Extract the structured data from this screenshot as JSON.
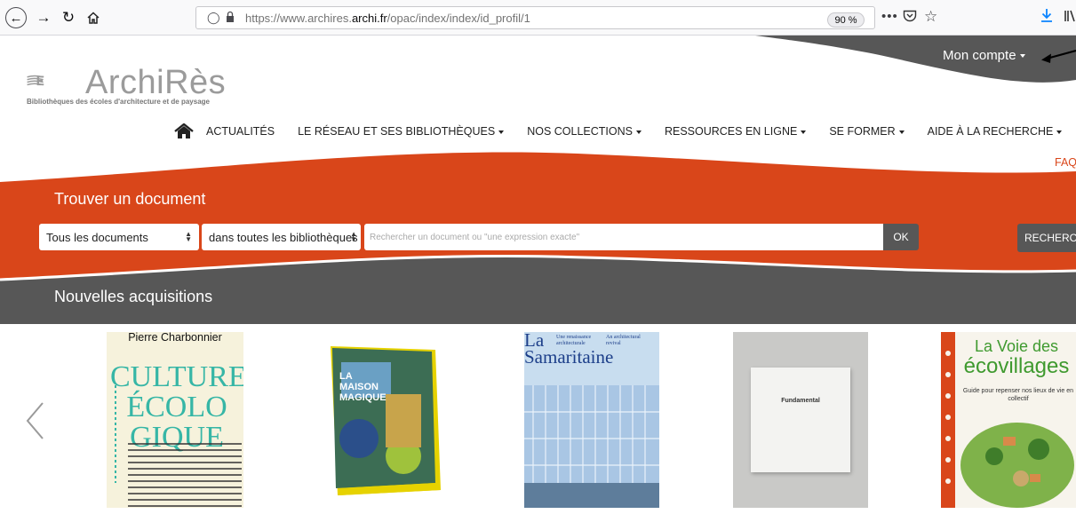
{
  "browser": {
    "url_prefix": "https://www.archires.",
    "url_domain": "archi.fr",
    "url_path": "/opac/index/index/id_profil/1",
    "zoom": "90 %",
    "more_label": "•••"
  },
  "header": {
    "account_label": "Mon compte",
    "logo_text": "ArchiRès",
    "logo_subtitle": "Bibliothèques des écoles d'architecture et de paysage"
  },
  "nav": {
    "items": [
      {
        "label": "ACTUALITÉS",
        "has_menu": false
      },
      {
        "label": "LE RÉSEAU ET SES BIBLIOTHÈQUES",
        "has_menu": true
      },
      {
        "label": "NOS COLLECTIONS",
        "has_menu": true
      },
      {
        "label": "RESSOURCES EN LIGNE",
        "has_menu": true
      },
      {
        "label": "SE FORMER",
        "has_menu": true
      },
      {
        "label": "AIDE À LA RECHERCHE",
        "has_menu": true
      }
    ],
    "faq": "FAQ"
  },
  "search": {
    "title": "Trouver un document",
    "doc_type": "Tous les documents",
    "library": "dans toutes les bibliothèques",
    "placeholder": "Rechercher un document ou \"une expression exacte\"",
    "ok_label": "OK",
    "advanced_label": "RECHERCHE"
  },
  "acquisitions": {
    "title": "Nouvelles acquisitions",
    "books": [
      {
        "author": "Pierre Charbonnier",
        "title_lines": [
          "CULTURE",
          "ÉCOLO",
          "GIQUE"
        ]
      },
      {
        "title_lines": [
          "LA MAISON",
          "MAGIQUE"
        ]
      },
      {
        "title_lines": [
          "La",
          "Samaritaine"
        ],
        "tagline_fr": "Une renaissance architecturale",
        "tagline_en": "An architectural revival"
      },
      {
        "title": "Fundamental"
      },
      {
        "title_line1": "La Voie des",
        "title_line2": "écovillages",
        "subtitle": "Guide pour repenser nos lieux de vie en collectif"
      }
    ]
  },
  "colors": {
    "orange": "#d9461a",
    "dark_gray": "#575757",
    "accent_blue": "#0a84ff"
  }
}
